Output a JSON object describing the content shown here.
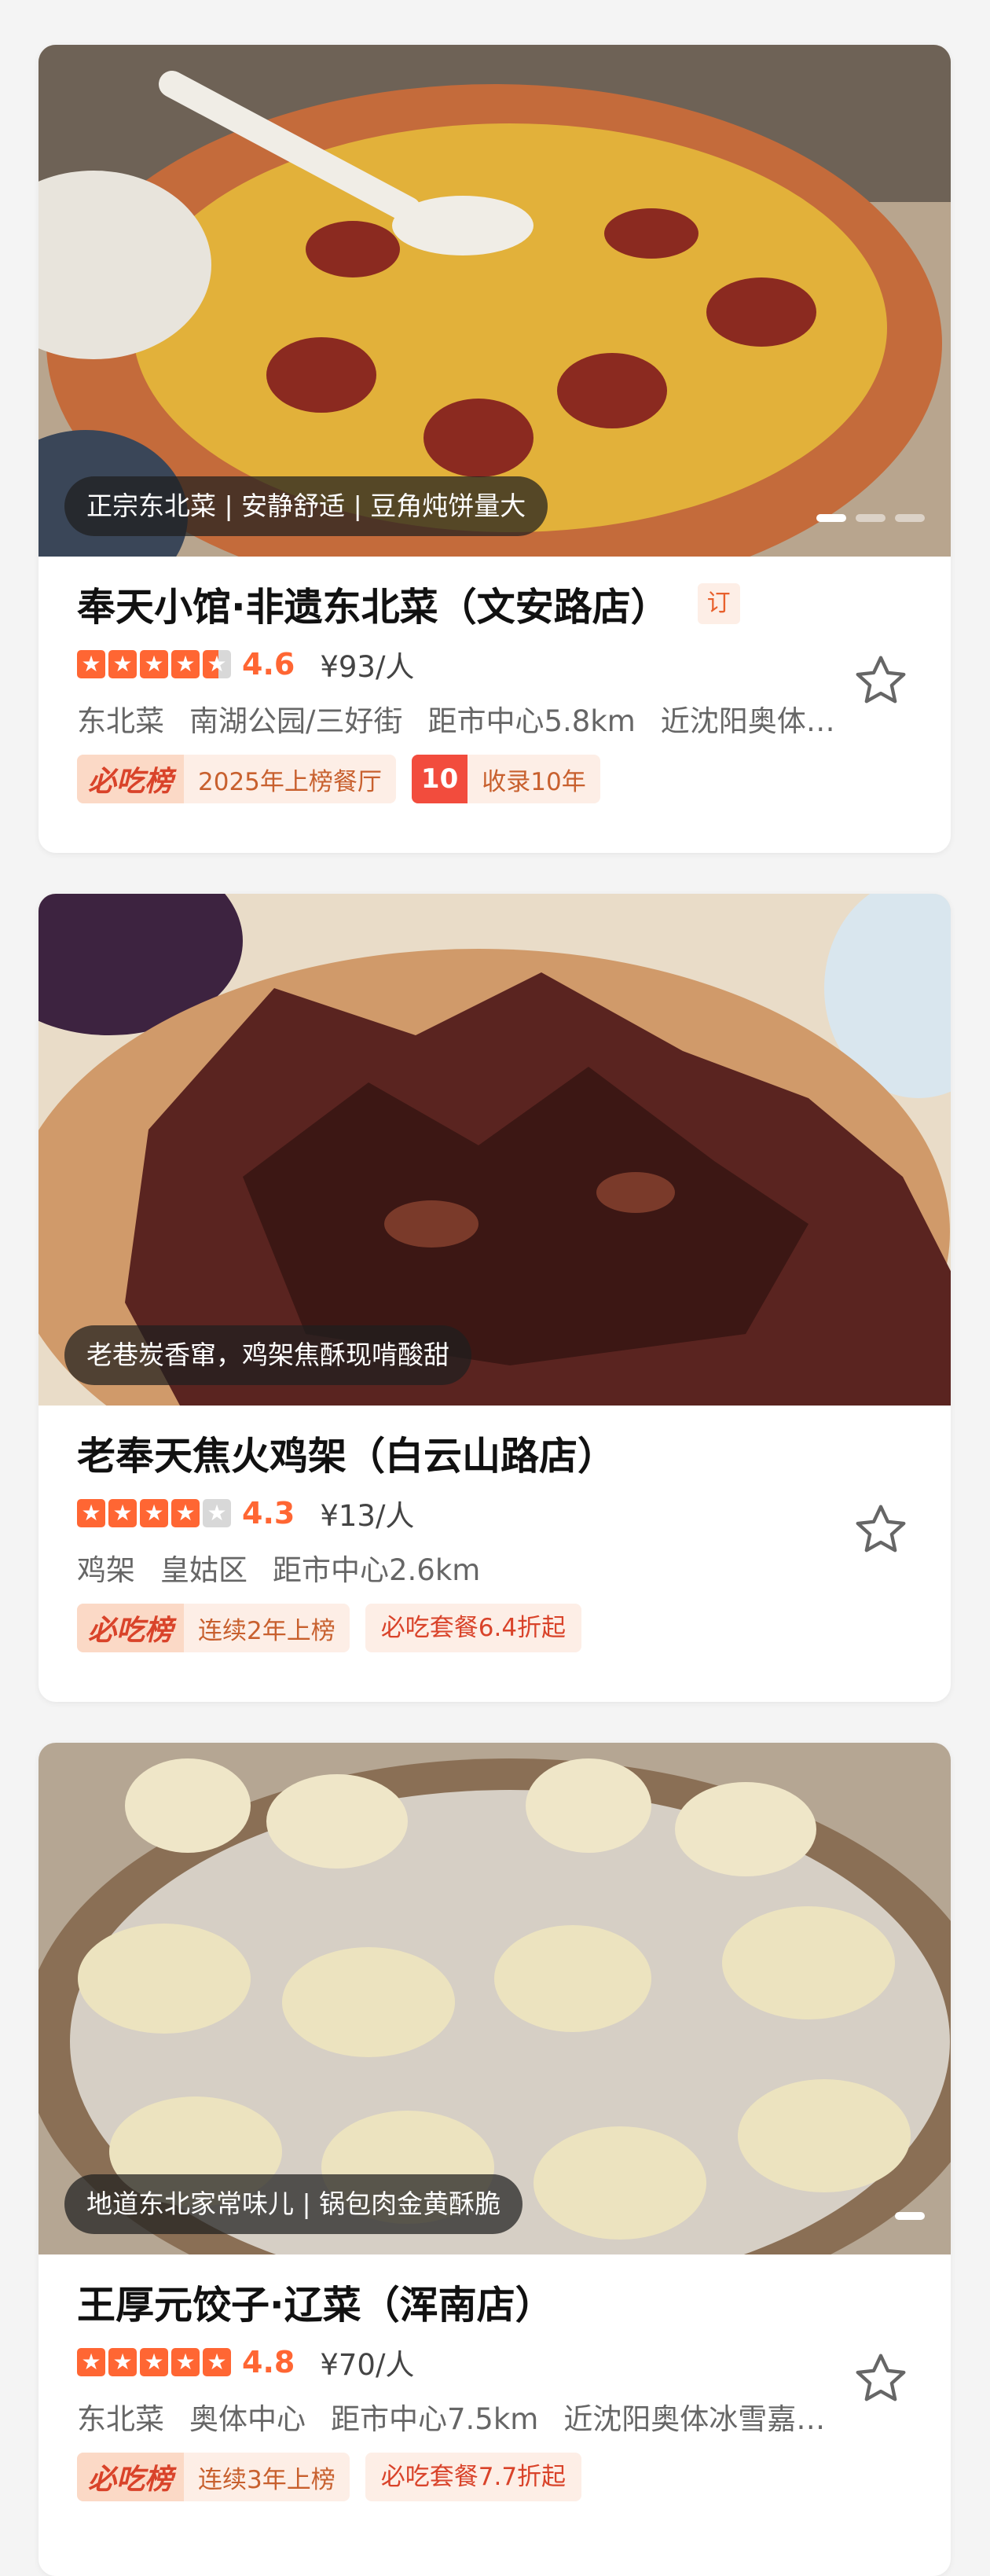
{
  "restaurants": [
    {
      "caption": "正宗东北菜 | 安静舒适 | 豆角炖饼量大",
      "name": "奉天小馆·非遗东北菜（文安路店）",
      "book_tag": "订",
      "rating": 4.6,
      "score_text": "4.6",
      "price": "¥93/人",
      "category": "东北菜",
      "area": "南湖公园/三好街",
      "distance": "距市中心5.8km",
      "near": "近沈阳奥体…",
      "bichi_logo": "必吃榜",
      "bichi_text": "2025年上榜餐厅",
      "count_num": "10",
      "count_text": "收录10年",
      "deal": ""
    },
    {
      "caption": "老巷炭香窜，鸡架焦酥现啃酸甜",
      "name": "老奉天焦火鸡架（白云山路店）",
      "book_tag": "",
      "rating": 4.3,
      "score_text": "4.3",
      "price": "¥13/人",
      "category": "鸡架",
      "area": "皇姑区",
      "distance": "距市中心2.6km",
      "near": "",
      "bichi_logo": "必吃榜",
      "bichi_text": "连续2年上榜",
      "count_num": "",
      "count_text": "",
      "deal": "必吃套餐6.4折起"
    },
    {
      "caption": "地道东北家常味儿 | 锅包肉金黄酥脆",
      "name": "王厚元饺子·辽菜（浑南店）",
      "book_tag": "",
      "rating": 4.8,
      "score_text": "4.8",
      "price": "¥70/人",
      "category": "东北菜",
      "area": "奥体中心",
      "distance": "距市中心7.5km",
      "near": "近沈阳奥体冰雪嘉…",
      "bichi_logo": "必吃榜",
      "bichi_text": "连续3年上榜",
      "count_num": "",
      "count_text": "",
      "deal": "必吃套餐7.7折起"
    }
  ],
  "icons": {
    "favorite": "star-outline-icon",
    "rating_star": "star-icon"
  },
  "colors": {
    "accent": "#ff6633",
    "badge_bg": "#fdeee6",
    "count_red": "#f24c3d"
  }
}
